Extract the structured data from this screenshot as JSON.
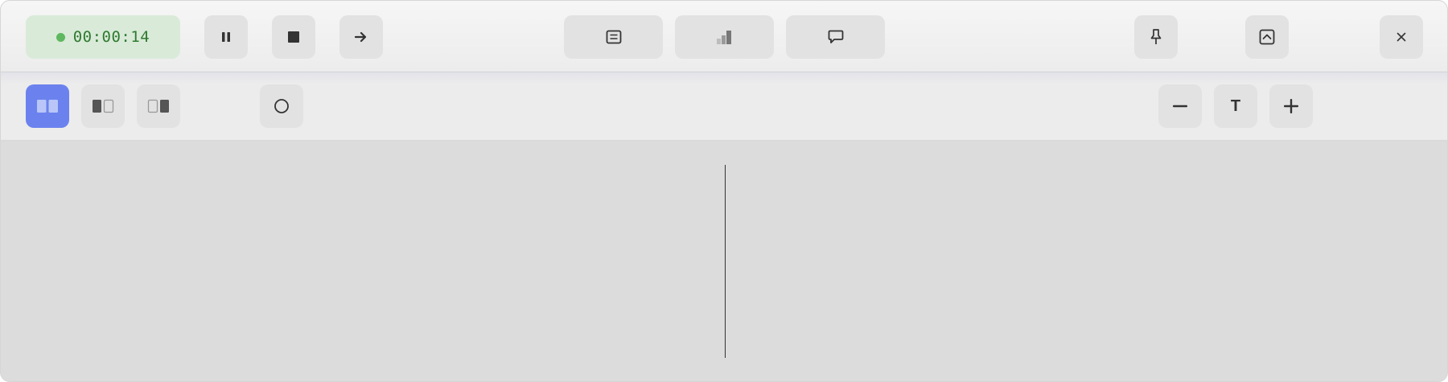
{
  "recording": {
    "status": "recording",
    "elapsed": "00:00:14",
    "indicator_color": "#5fb85f"
  },
  "controls": {
    "pause_icon": "pause-icon",
    "stop_icon": "stop-icon",
    "next_icon": "arrow-right-icon"
  },
  "panels": {
    "notes_icon": "notes-icon",
    "levels_icon": "signal-bars-icon",
    "chat_icon": "chat-bubble-icon"
  },
  "window_actions": {
    "pin_icon": "pin-icon",
    "collapse_icon": "collapse-up-icon",
    "close_icon": "close-icon"
  },
  "layout_modes": {
    "selected": "split-equal",
    "accent_color": "#6b82ee",
    "options": [
      "split-equal",
      "focus-left",
      "focus-right"
    ]
  },
  "record_toggle_icon": "circle-icon",
  "font_controls": {
    "decrease_icon": "minus-icon",
    "label": "T",
    "increase_icon": "plus-icon"
  }
}
